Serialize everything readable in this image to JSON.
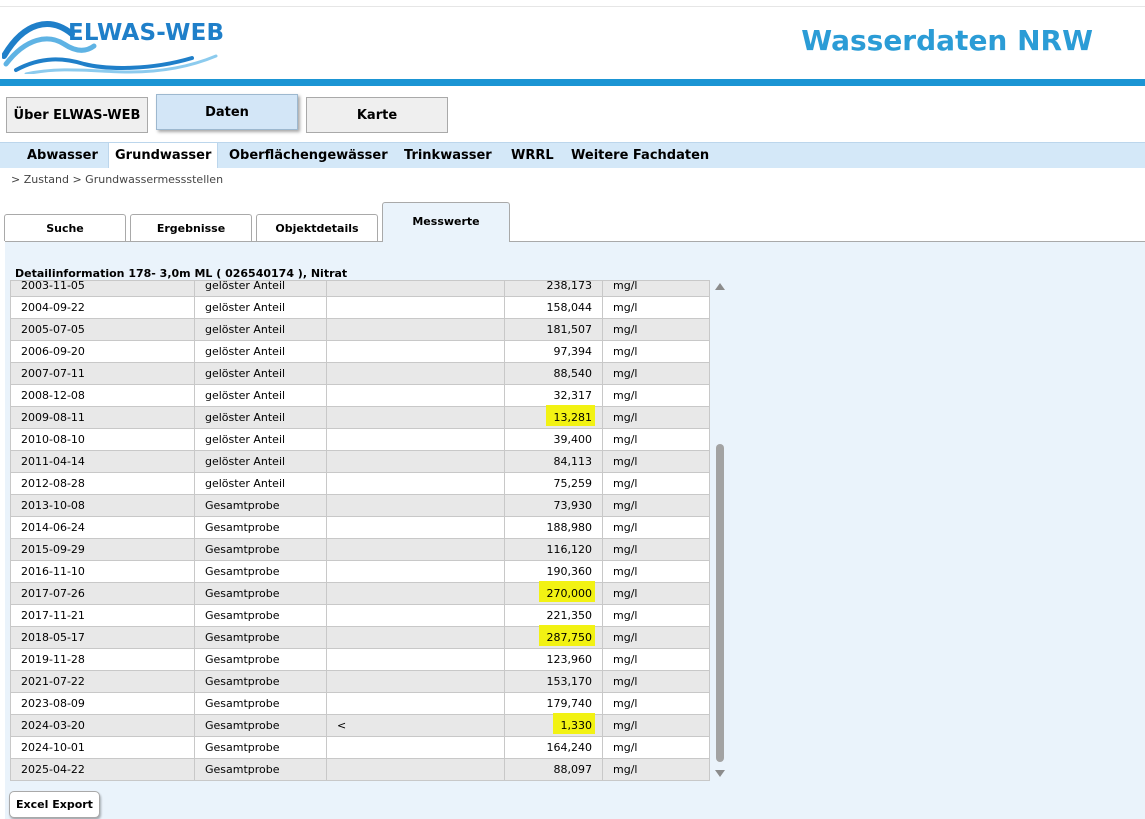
{
  "header": {
    "logo_text": "ELWAS-WEB",
    "site_title": "Wasserdaten NRW",
    "accent_color": "#1b95d4"
  },
  "main_nav": [
    {
      "label": "Über ELWAS-WEB",
      "active": false
    },
    {
      "label": "Daten",
      "active": true
    },
    {
      "label": "Karte",
      "active": false
    }
  ],
  "sub_nav": [
    {
      "label": "Abwasser",
      "active": false
    },
    {
      "label": "Grundwasser",
      "active": true
    },
    {
      "label": "Oberflächengewässer",
      "active": false
    },
    {
      "label": "Trinkwasser",
      "active": false
    },
    {
      "label": "WRRL",
      "active": false
    },
    {
      "label": "Weitere Fachdaten",
      "active": false
    }
  ],
  "breadcrumb": "> Zustand > Grundwassermessstellen",
  "tabs": [
    {
      "label": "Suche",
      "active": false
    },
    {
      "label": "Ergebnisse",
      "active": false
    },
    {
      "label": "Objektdetails",
      "active": false
    },
    {
      "label": "Messwerte",
      "active": true
    }
  ],
  "detail_title": "Detailinformation 178- 3,0m ML ( 026540174 ), Nitrat",
  "rows": [
    [
      "2003-11-05",
      "gelöster Anteil",
      "",
      "238,173",
      "mg/l"
    ],
    [
      "2004-09-22",
      "gelöster Anteil",
      "",
      "158,044",
      "mg/l"
    ],
    [
      "2005-07-05",
      "gelöster Anteil",
      "",
      "181,507",
      "mg/l"
    ],
    [
      "2006-09-20",
      "gelöster Anteil",
      "",
      "97,394",
      "mg/l"
    ],
    [
      "2007-07-11",
      "gelöster Anteil",
      "",
      "88,540",
      "mg/l"
    ],
    [
      "2008-12-08",
      "gelöster Anteil",
      "",
      "32,317",
      "mg/l"
    ],
    [
      "2009-08-11",
      "gelöster Anteil",
      "",
      "13,281",
      "mg/l"
    ],
    [
      "2010-08-10",
      "gelöster Anteil",
      "",
      "39,400",
      "mg/l"
    ],
    [
      "2011-04-14",
      "gelöster Anteil",
      "",
      "84,113",
      "mg/l"
    ],
    [
      "2012-08-28",
      "gelöster Anteil",
      "",
      "75,259",
      "mg/l"
    ],
    [
      "2013-10-08",
      "Gesamtprobe",
      "",
      "73,930",
      "mg/l"
    ],
    [
      "2014-06-24",
      "Gesamtprobe",
      "",
      "188,980",
      "mg/l"
    ],
    [
      "2015-09-29",
      "Gesamtprobe",
      "",
      "116,120",
      "mg/l"
    ],
    [
      "2016-11-10",
      "Gesamtprobe",
      "",
      "190,360",
      "mg/l"
    ],
    [
      "2017-07-26",
      "Gesamtprobe",
      "",
      "270,000",
      "mg/l"
    ],
    [
      "2017-11-21",
      "Gesamtprobe",
      "",
      "221,350",
      "mg/l"
    ],
    [
      "2018-05-17",
      "Gesamtprobe",
      "",
      "287,750",
      "mg/l"
    ],
    [
      "2019-11-28",
      "Gesamtprobe",
      "",
      "123,960",
      "mg/l"
    ],
    [
      "2021-07-22",
      "Gesamtprobe",
      "",
      "153,170",
      "mg/l"
    ],
    [
      "2023-08-09",
      "Gesamtprobe",
      "",
      "179,740",
      "mg/l"
    ],
    [
      "2024-03-20",
      "Gesamtprobe",
      "<",
      "1,330",
      "mg/l"
    ],
    [
      "2024-10-01",
      "Gesamtprobe",
      "",
      "164,240",
      "mg/l"
    ],
    [
      "2025-04-22",
      "Gesamtprobe",
      "",
      "88,097",
      "mg/l"
    ]
  ],
  "highlighted_rows": [
    6,
    14,
    16,
    20
  ],
  "highlight_color": "#f2f213",
  "excel_export_label": "Excel Export"
}
